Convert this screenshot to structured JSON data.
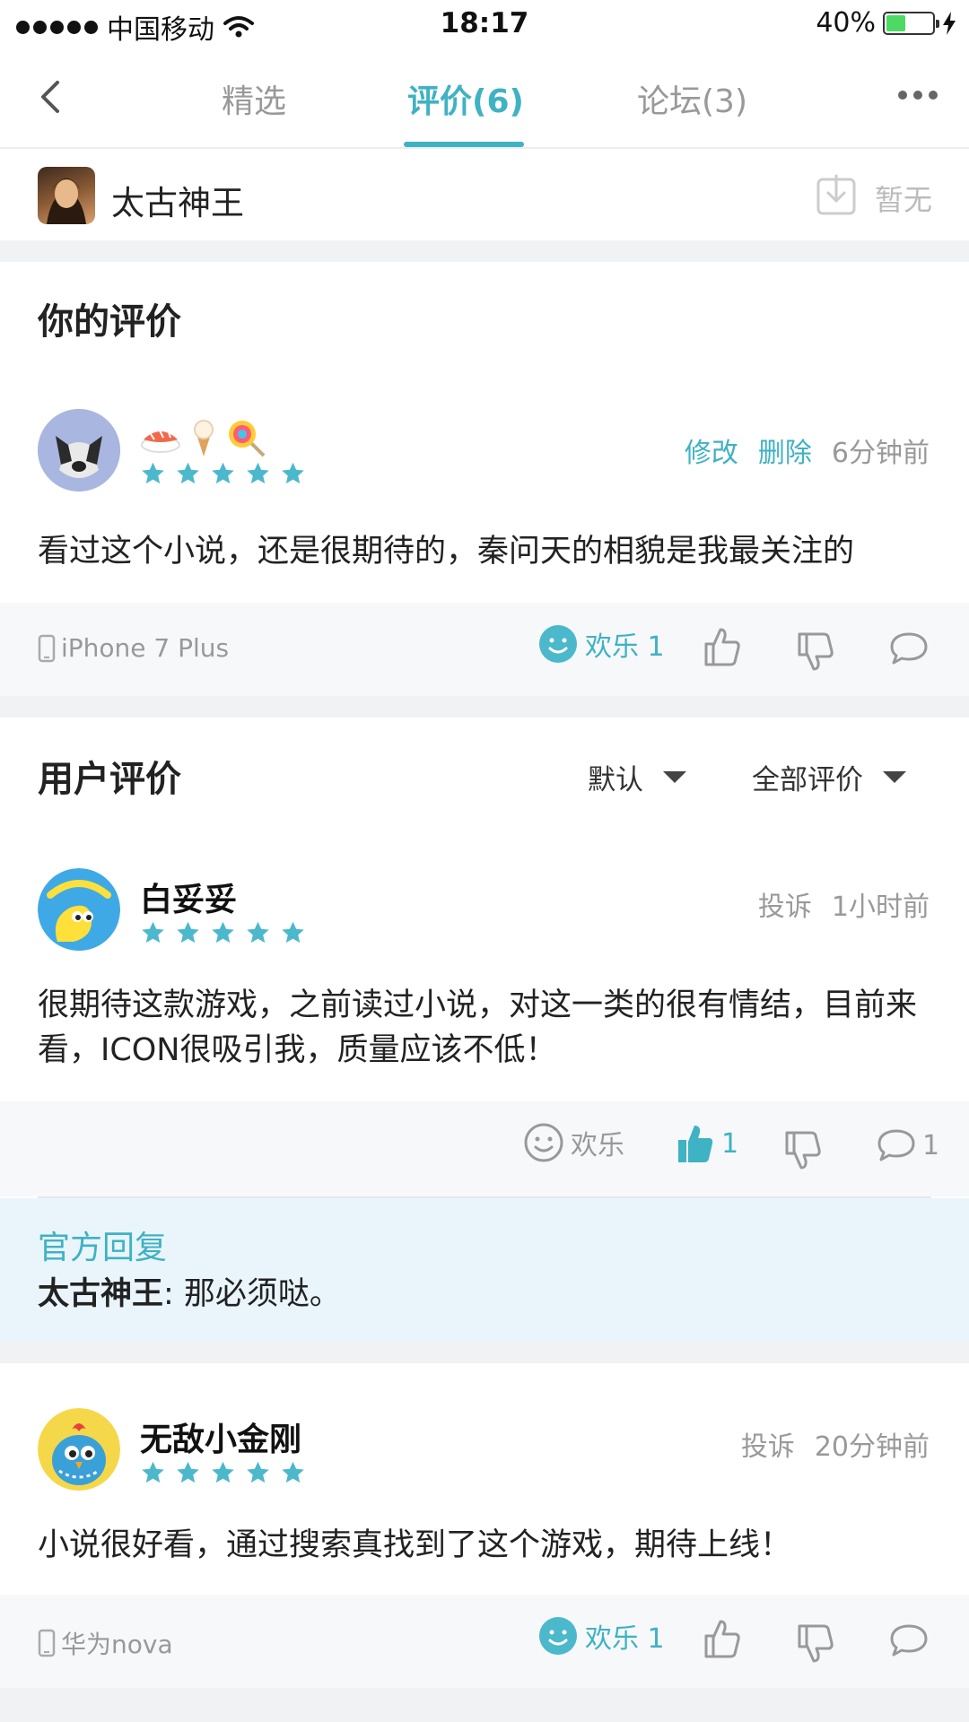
{
  "status_bar": {
    "carrier": "中国移动",
    "time": "18:17",
    "battery": "40%"
  },
  "nav": {
    "tabs": [
      {
        "label": "精选",
        "active": false
      },
      {
        "label": "评价(6)",
        "active": true
      },
      {
        "label": "论坛(3)",
        "active": false
      }
    ]
  },
  "game": {
    "name": "太古神王",
    "download_label": "暂无"
  },
  "my_review": {
    "title": "你的评价",
    "stars": 5,
    "edit_label": "修改",
    "delete_label": "删除",
    "time": "6分钟前",
    "text": "看过这个小说，还是很期待的，秦问天的相貌是我最关注的",
    "device": "iPhone 7 Plus",
    "emotion_label": "欢乐 1"
  },
  "user_reviews": {
    "title": "用户评价",
    "sort_label": "默认",
    "filter_label": "全部评价",
    "items": [
      {
        "username": "白妥妥",
        "stars": 5,
        "report_label": "投诉",
        "time": "1小时前",
        "text": "很期待这款游戏，之前读过小说，对这一类的很有情结，目前来看，ICON很吸引我，质量应该不低！",
        "emotion_label": "欢乐",
        "like_count": "1",
        "comment_count": "1",
        "official_reply": {
          "title": "官方回复",
          "author": "太古神王",
          "text": ": 那必须哒。"
        }
      },
      {
        "username": "无敌小金刚",
        "stars": 5,
        "report_label": "投诉",
        "time": "20分钟前",
        "text": "小说很好看，通过搜索真找到了这个游戏，期待上线！",
        "device": "华为nova",
        "emotion_label": "欢乐 1"
      }
    ]
  },
  "colors": {
    "accent": "#3fb2c3",
    "muted": "#999999",
    "reply_bg": "#e9f5fb"
  }
}
